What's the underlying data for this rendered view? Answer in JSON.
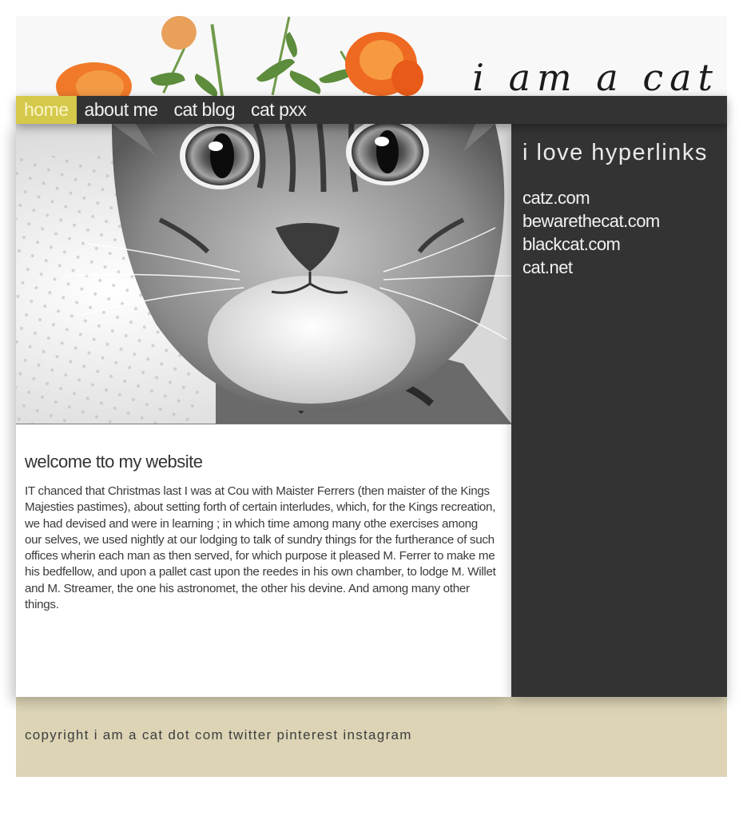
{
  "header": {
    "title": "i am a cat"
  },
  "nav": {
    "items": [
      {
        "label": "home",
        "active": true
      },
      {
        "label": "about me",
        "active": false
      },
      {
        "label": "cat blog",
        "active": false
      },
      {
        "label": "cat pxx",
        "active": false
      }
    ]
  },
  "main": {
    "heading": "welcome tto my website",
    "body": "IT chanced that Christmas last I was at Cou with Maister Ferrers (then maister of the Kings Majesties pastimes), about setting forth of certain interludes, which, for the Kings recreation, we had devised and were in learning ; in which time among many othe exercises among our selves, we used nightly at our lodging to talk of sundry things for the furtherance of such offices wherin each man as then served, for which purpose it pleased M. Ferrer to make me his bedfellow, and upon a pallet cast upon the reedes in his own chamber, to lodge M. Willet and M. Streamer, the one his astronomet, the other his devine. And among many other things."
  },
  "sidebar": {
    "heading": "i love hyperlinks",
    "links": [
      "catz.com",
      "bewarethecat.com",
      "blackcat.com",
      "cat.net"
    ]
  },
  "footer": {
    "text": "copyright i am a cat dot com twitter pinterest instagram"
  },
  "colors": {
    "nav_background": "#333333",
    "nav_active": "#d4c94a",
    "sidebar_background": "#333333",
    "footer_background": "#dcd4b5",
    "flower": "#f07a2a"
  }
}
